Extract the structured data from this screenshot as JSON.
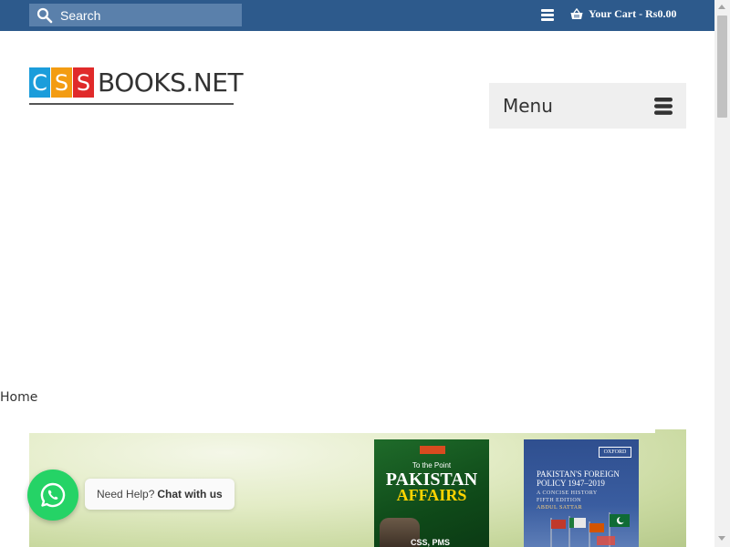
{
  "header": {
    "search_placeholder": "Search",
    "cart_label": "Your Cart - Rs0.00"
  },
  "logo": {
    "letters": [
      "C",
      "S",
      "S"
    ],
    "word": "BOOKS.NET",
    "colors": [
      "#1b9ddb",
      "#f39c12",
      "#e02a2a"
    ]
  },
  "nav": {
    "menu_label": "Menu"
  },
  "breadcrumb": {
    "home": "Home"
  },
  "banner": {
    "book1": {
      "tagline": "To the Point",
      "title_line1": "PAKISTAN",
      "title_line2": "AFFAIRS",
      "subtitle": "CSS, PMS"
    },
    "book2": {
      "publisher": "OXFORD",
      "title_line1": "PAKISTAN'S FOREIGN",
      "title_line2": "POLICY 1947–2019",
      "subtitle": "A CONCISE HISTORY",
      "edition": "FIFTH EDITION",
      "author": "ABDUL SATTAR"
    }
  },
  "whatsapp": {
    "prefix": "Need Help?",
    "action": "Chat with us"
  },
  "colors": {
    "topbar": "#2d5a8c",
    "whatsapp": "#25d366"
  }
}
